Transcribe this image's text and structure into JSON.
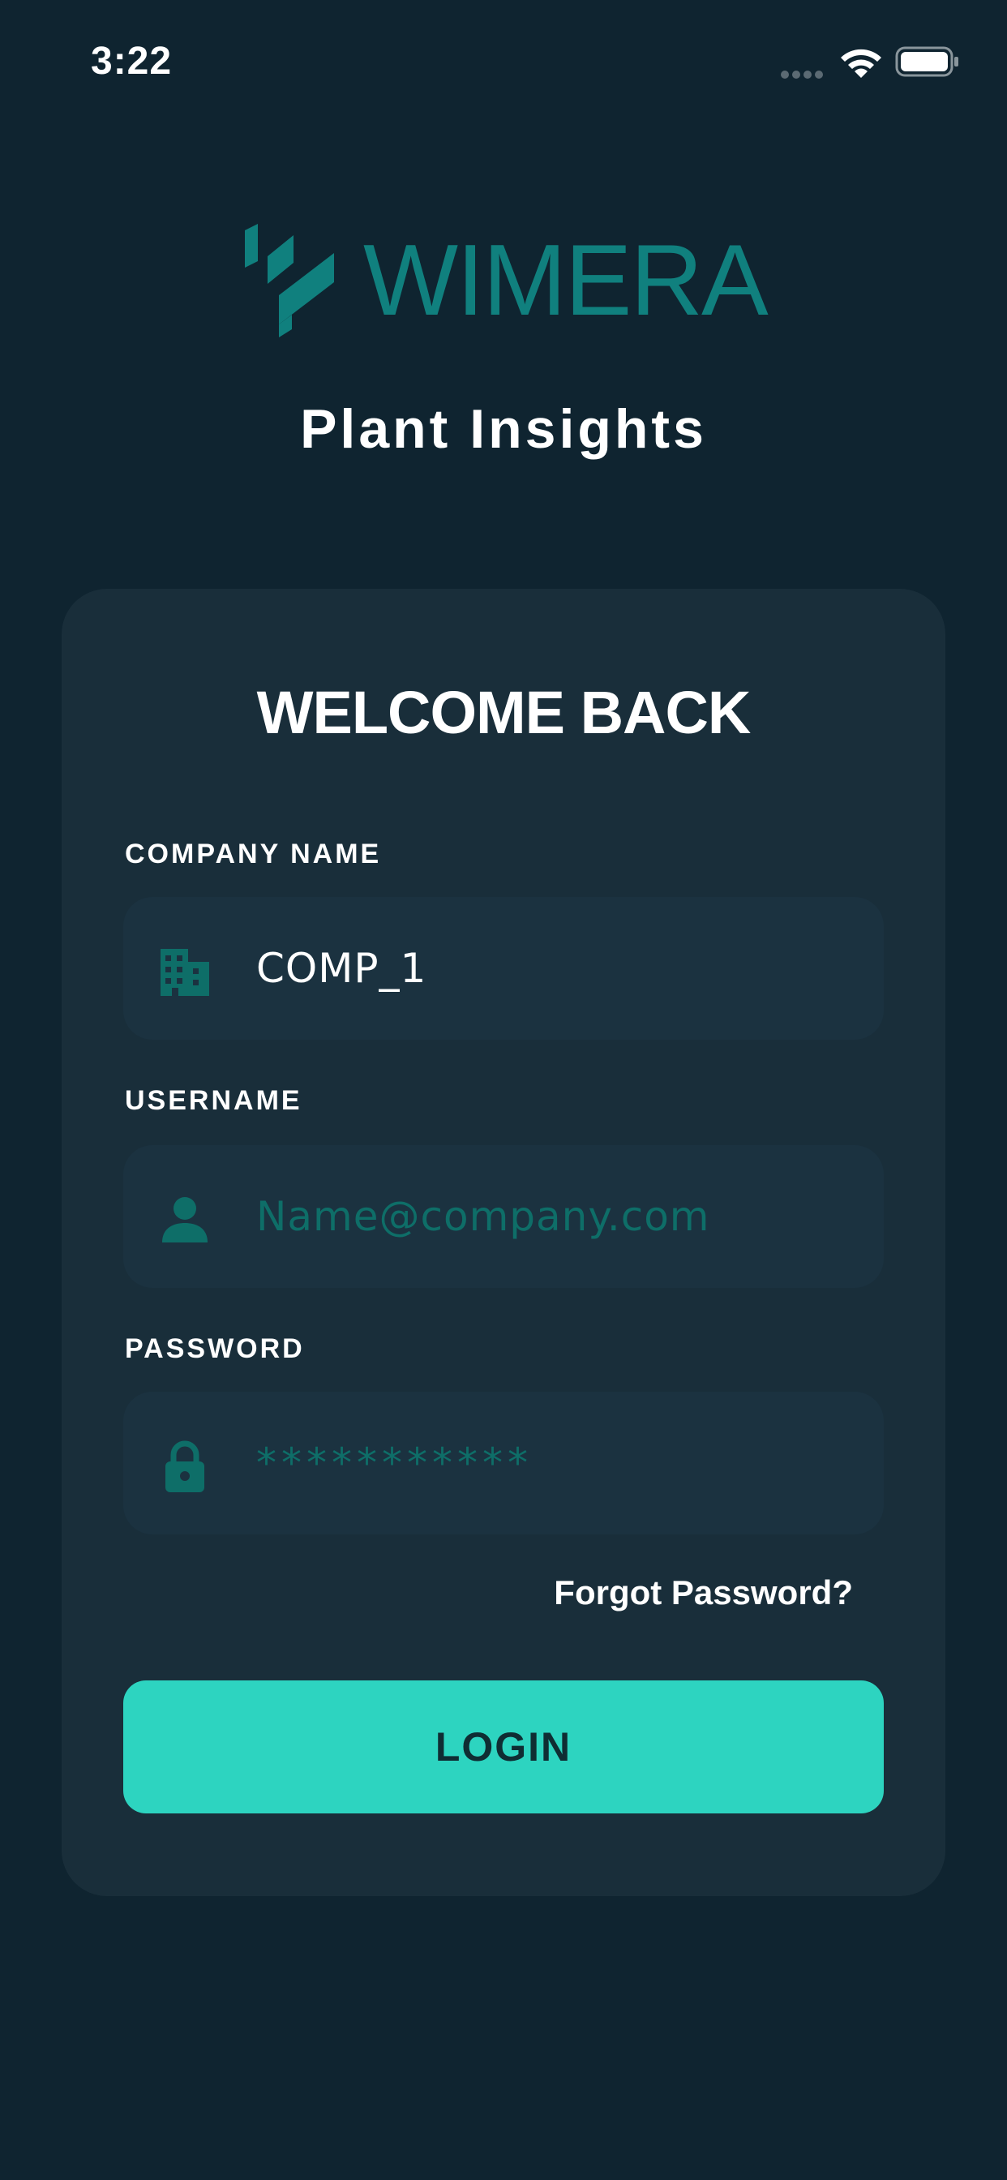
{
  "status_bar": {
    "time": "3:22"
  },
  "logo": {
    "text": "WIMERA",
    "color": "#10807e"
  },
  "app": {
    "subtitle": "Plant Insights"
  },
  "card": {
    "title": "WELCOME BACK",
    "fields": {
      "company": {
        "label": "COMPANY NAME",
        "value": "COMP_1",
        "icon": "building-icon"
      },
      "username": {
        "label": "USERNAME",
        "value": "",
        "placeholder": "Name@company.com",
        "icon": "user-icon"
      },
      "password": {
        "label": "PASSWORD",
        "value": "",
        "placeholder": "***********",
        "icon": "lock-icon"
      }
    },
    "forgot_password": "Forgot Password?",
    "login_label": "LOGIN"
  },
  "colors": {
    "background": "#0f2430",
    "card": "#192e3a",
    "field": "#1b3240",
    "accent": "#2dd4c0",
    "icon": "#0e6e68"
  }
}
